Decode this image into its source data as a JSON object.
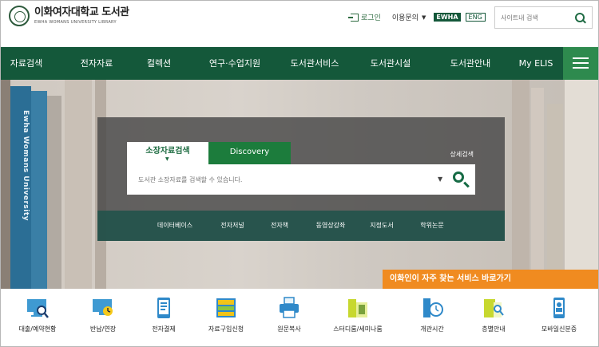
{
  "header": {
    "logo_title": "이화여자대학교 도서관",
    "logo_sub": "EWHA WOMANS UNIVERSITY LIBRARY",
    "login_label": "로그인",
    "inquiry_label": "이용문의",
    "ewha_label": "EWHA",
    "eng_label": "ENG",
    "site_search_placeholder": "사이트내 검색"
  },
  "nav": {
    "items": [
      "자료검색",
      "전자자료",
      "컬렉션",
      "연구·수업지원",
      "도서관서비스",
      "도서관시설",
      "도서관안내",
      "My ELIS"
    ]
  },
  "hero": {
    "book_spine_text": "Ewha Womans University",
    "search": {
      "tab_holdings": "소장자료검색",
      "tab_discovery": "Discovery",
      "detail_search": "상세검색",
      "placeholder": "도서관 소장자료를 검색할 수 있습니다."
    },
    "quick_links": [
      "데이터베이스",
      "전자저널",
      "전자책",
      "동영상강좌",
      "지정도서",
      "학위논문"
    ],
    "banner": "이화인이 자주 찾는 서비스 바로가기"
  },
  "services": [
    {
      "label": "대출/예약현황",
      "icon": "monitor-search-icon"
    },
    {
      "label": "반납/연장",
      "icon": "monitor-clock-icon"
    },
    {
      "label": "전자결제",
      "icon": "mobile-payment-icon"
    },
    {
      "label": "자료구입신청",
      "icon": "shelf-request-icon"
    },
    {
      "label": "원문복사",
      "icon": "printer-icon"
    },
    {
      "label": "스터디룸/세미나룸",
      "icon": "study-room-icon"
    },
    {
      "label": "개관시간",
      "icon": "opening-hours-icon"
    },
    {
      "label": "층별안내",
      "icon": "floor-guide-icon"
    },
    {
      "label": "모바일신분증",
      "icon": "mobile-id-icon"
    }
  ],
  "colors": {
    "primary_green": "#14583a",
    "accent_green": "#2e8a4e",
    "banner_orange": "#f08b20"
  }
}
